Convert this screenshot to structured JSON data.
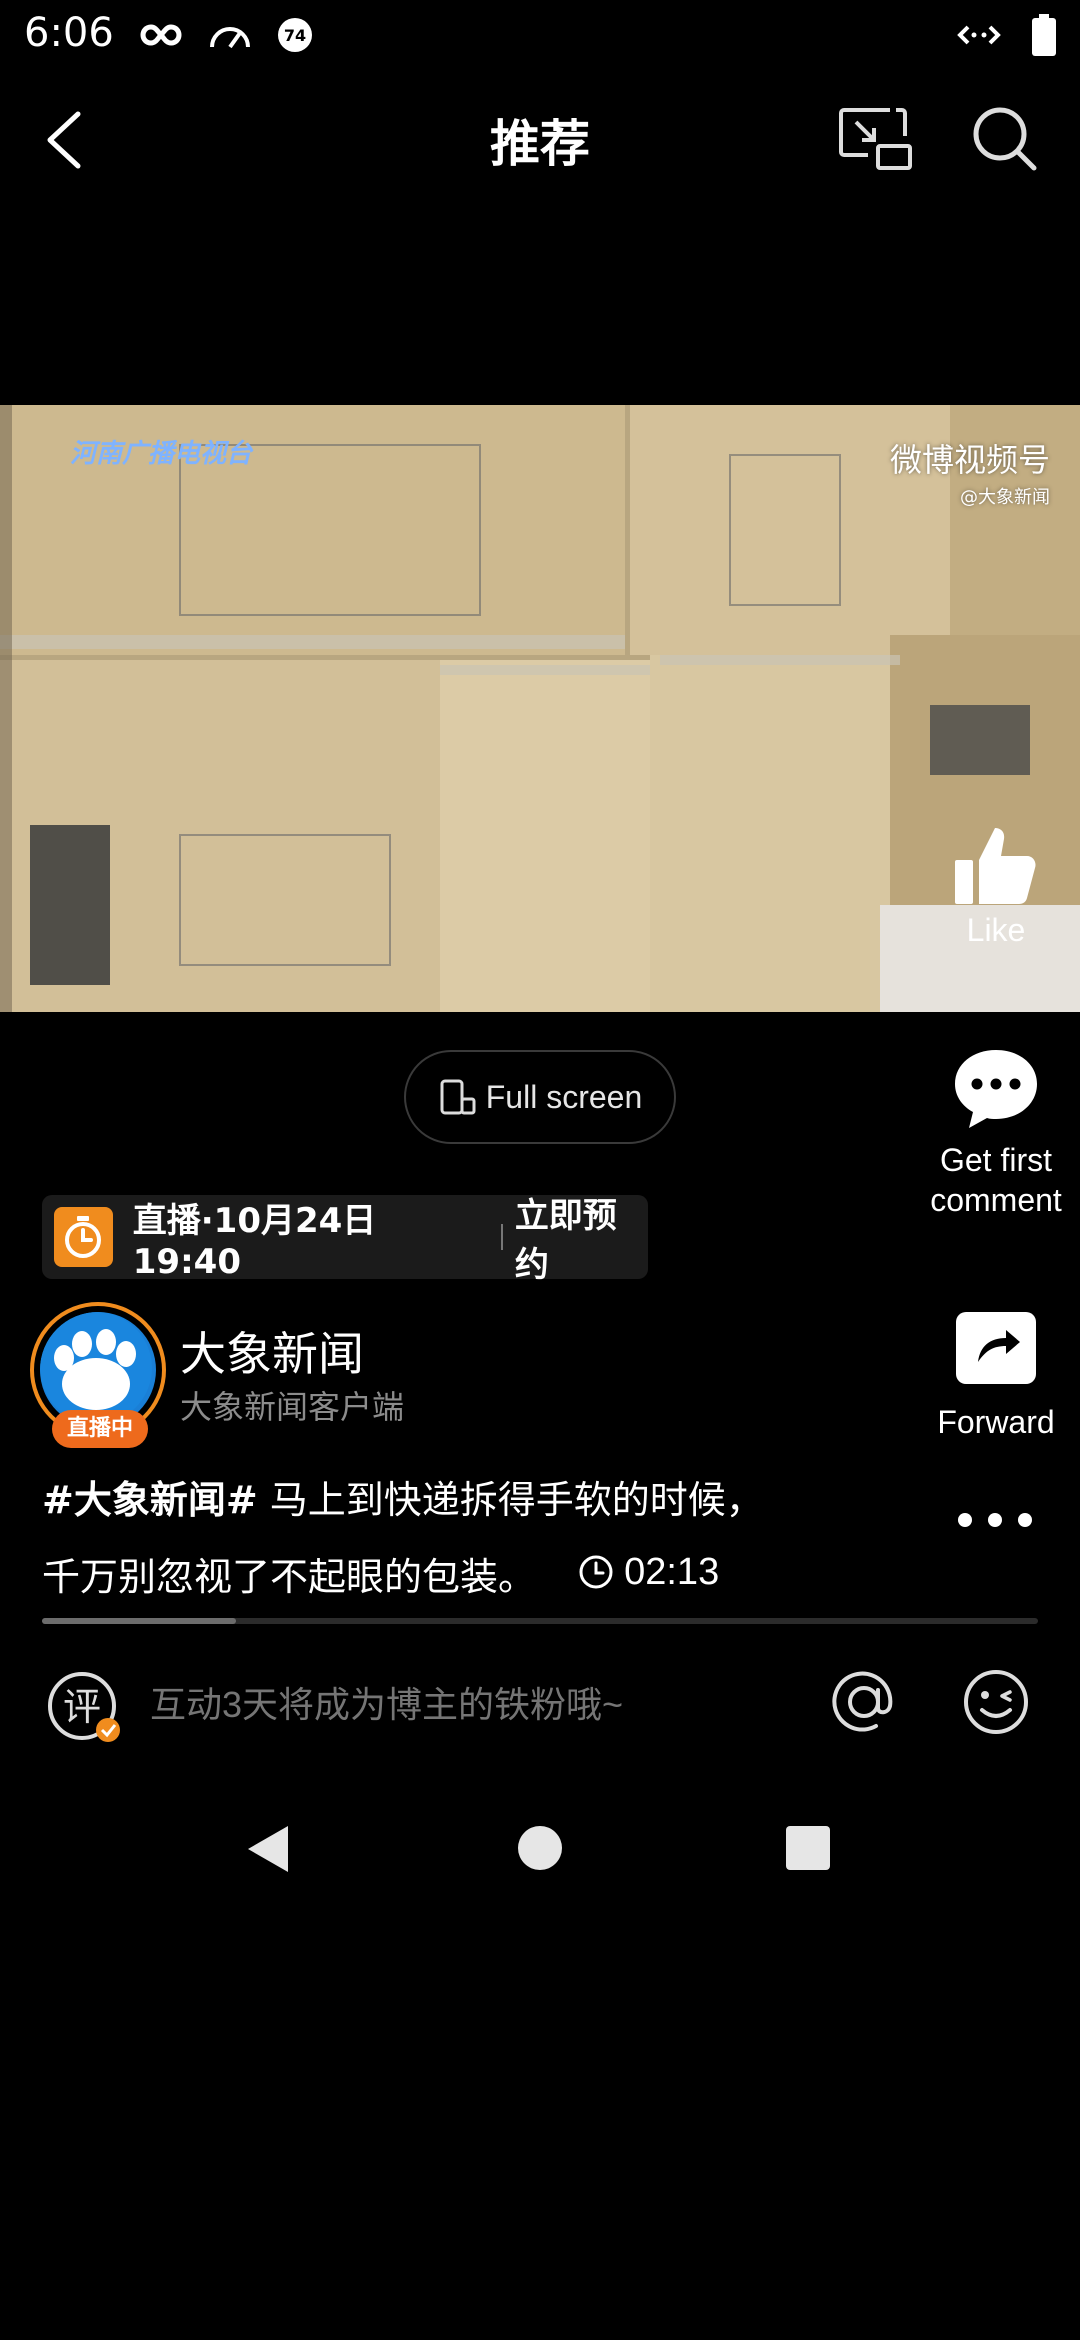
{
  "status_bar": {
    "time": "6:06",
    "battery_badge": "74",
    "icons_left": [
      "infinity-icon",
      "gauge-icon",
      "badge-74-icon"
    ],
    "icons_right": [
      "data-arrows-icon",
      "battery-icon"
    ]
  },
  "header": {
    "title": "推荐",
    "back_icon": "chevron-left-icon",
    "pip_icon": "picture-in-picture-icon",
    "search_icon": "search-icon"
  },
  "video": {
    "watermark_left": "河南广播电视台",
    "watermark_right_line1": "微博视频号",
    "watermark_right_line2": "@大象新闻"
  },
  "actions": {
    "like_label": "Like",
    "comment_label": "Get first comment",
    "forward_label": "Forward",
    "more_icon": "more-dots-icon"
  },
  "fullscreen": {
    "label": "Full screen"
  },
  "live_card": {
    "text": "直播·10月24日 19:40",
    "reserve": "立即预约",
    "accent": "#F08C1E"
  },
  "author": {
    "name": "大象新闻",
    "subtitle": "大象新闻客户端",
    "live_badge": "直播中"
  },
  "post": {
    "hashtag": "#大象新闻#",
    "line1": " 马上到快递拆得手软的时候，",
    "line2": "千万别忽视了不起眼的包装。",
    "duration": "02:13"
  },
  "progress": {
    "fraction": 0.195
  },
  "comment_bar": {
    "placeholder": "互动3天将成为博主的铁粉哦~",
    "comment_icon_text": "评"
  }
}
